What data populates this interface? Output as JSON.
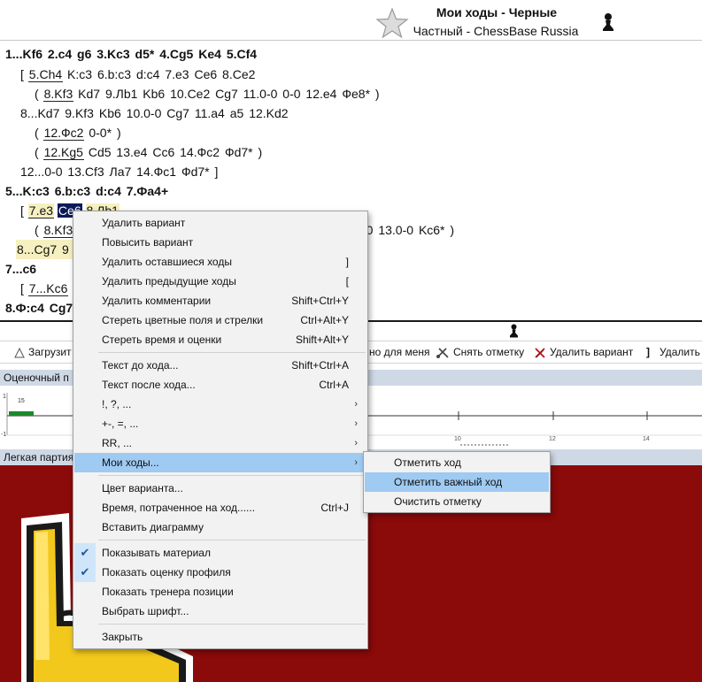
{
  "header": {
    "title": "Мои ходы - Черные",
    "subtitle": "Частный - ChessBase Russia",
    "star_icon": "star-icon",
    "pawn_icon": "black-pawn-icon"
  },
  "notation": {
    "line1": [
      "1...Kf6",
      "2.c4",
      "g6",
      "3.Kc3",
      "d5*",
      "4.Cg5",
      "Ke4",
      "5.Cf4"
    ],
    "line2": [
      "[",
      "5.Ch4",
      "K:c3",
      "6.b:c3",
      "d:c4",
      "7.e3",
      "Ce6",
      "8.Ce2"
    ],
    "line3": [
      "(",
      "8.Kf3",
      "Kd7",
      "9.Лb1",
      "Kb6",
      "10.Ce2",
      "Cg7",
      "11.0-0",
      "0-0",
      "12.e4",
      "Фe8*",
      ")"
    ],
    "line4": [
      "8...Kd7",
      "9.Kf3",
      "Kb6",
      "10.0-0",
      "Cg7",
      "11.a4",
      "a5",
      "12.Kd2"
    ],
    "line5": [
      "(",
      "12.Фc2",
      "0-0*",
      ")"
    ],
    "line6": [
      "(",
      "12.Kg5",
      "Cd5",
      "13.e4",
      "Cc6",
      "14.Фc2",
      "Фd7*",
      ")"
    ],
    "line7": [
      "12...0-0",
      "13.Cf3",
      "Лa7",
      "14.Фc1",
      "Фd7*",
      "]"
    ],
    "line8": [
      "5...K:c3",
      "6.b:c3",
      "d:c4",
      "7.Фa4+"
    ],
    "line9": [
      "[",
      "7.e3",
      "Ce6",
      "8.Лb1"
    ],
    "line10a": [
      "(",
      "8.Kf3"
    ],
    "line10b": [
      "-0",
      "13.0-0",
      "Kc6*",
      ")"
    ],
    "line11": [
      "8...Cg7",
      "9"
    ],
    "line12": [
      "7...c6"
    ],
    "line13": [
      "[",
      "7...Kc6"
    ],
    "line14": [
      "8.Ф:c4",
      "Cg7"
    ]
  },
  "toolbar": {
    "load_label": "Загрузит",
    "for_me_label": "но для меня",
    "unmark_label": "Снять отметку",
    "delete_variant_label": "Удалить вариант",
    "bracket_label": "]",
    "delete_label": "Удалить"
  },
  "eval_panel": {
    "title": "Оценочный п",
    "bar_value": "15",
    "y_labels": [
      "1",
      "-1"
    ],
    "x_labels": [
      "10",
      "12",
      "14"
    ]
  },
  "easy_panel": {
    "title": "Легкая партия"
  },
  "menu": {
    "items": [
      {
        "label": "Удалить вариант",
        "shortcut": ""
      },
      {
        "label": "Повысить вариант",
        "shortcut": ""
      },
      {
        "label": "Удалить оставшиеся ходы",
        "shortcut": "]"
      },
      {
        "label": "Удалить предыдущие ходы",
        "shortcut": "["
      },
      {
        "label": "Удалить комментарии",
        "shortcut": "Shift+Ctrl+Y"
      },
      {
        "label": "Стереть цветные поля и стрелки",
        "shortcut": "Ctrl+Alt+Y"
      },
      {
        "label": "Стереть время и оценки",
        "shortcut": "Shift+Alt+Y"
      },
      {
        "label": "Текст до хода...",
        "shortcut": "Shift+Ctrl+A"
      },
      {
        "label": "Текст после хода...",
        "shortcut": "Ctrl+A"
      },
      {
        "label": "!, ?, ...",
        "shortcut": ""
      },
      {
        "label": "+-, =, ...",
        "shortcut": ""
      },
      {
        "label": "RR, ...",
        "shortcut": ""
      },
      {
        "label": "Мои ходы...",
        "shortcut": ""
      },
      {
        "label": "Цвет варианта...",
        "shortcut": ""
      },
      {
        "label": "Время, потраченное на ход......",
        "shortcut": "Ctrl+J"
      },
      {
        "label": "Вставить диаграмму",
        "shortcut": ""
      },
      {
        "label": "Показывать материал",
        "shortcut": "",
        "checked": true
      },
      {
        "label": "Показать оценку профиля",
        "shortcut": "",
        "checked": true
      },
      {
        "label": "Показать тренера позиции",
        "shortcut": ""
      },
      {
        "label": "Выбрать шрифт...",
        "shortcut": ""
      },
      {
        "label": "Закрыть",
        "shortcut": ""
      }
    ],
    "check_glyph": "✔",
    "arrow_glyph": "›"
  },
  "submenu": {
    "items": [
      {
        "label": "Отметить ход"
      },
      {
        "label": "Отметить важный ход"
      },
      {
        "label": "Очистить отметку"
      }
    ]
  },
  "colors": {
    "selection": "#0b1a57",
    "menu_highlight": "#9fcaf2",
    "panel_header": "#cfd9e6",
    "bottom_background": "#8b0a0a"
  }
}
